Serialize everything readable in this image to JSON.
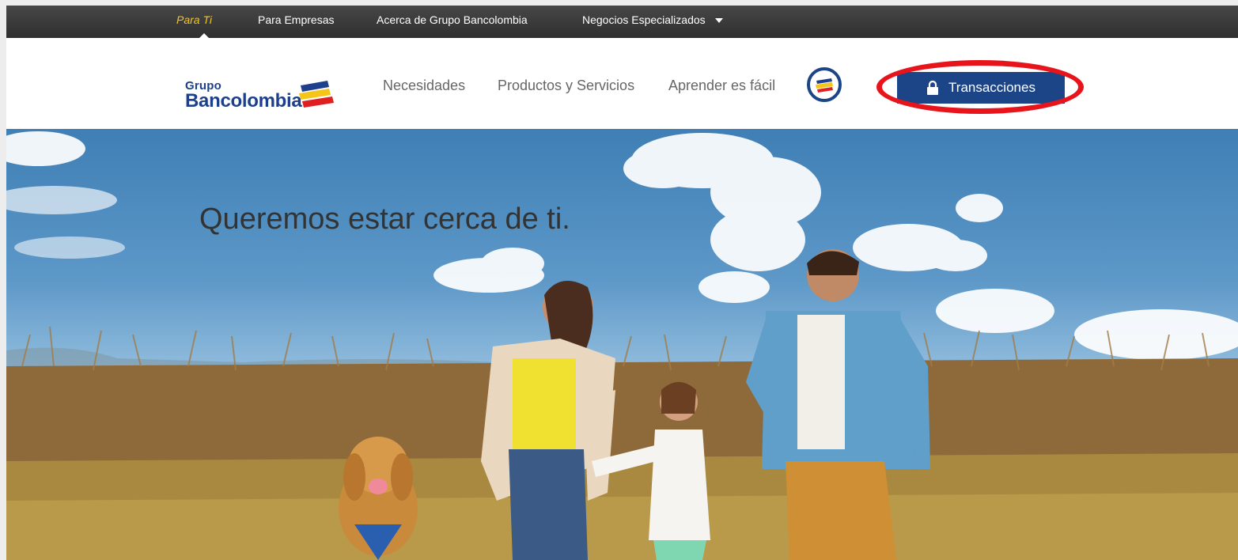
{
  "topbar": {
    "items": [
      {
        "label": "Para Ti",
        "active": true
      },
      {
        "label": "Para Empresas"
      },
      {
        "label": "Acerca de Grupo Bancolombia"
      },
      {
        "label": "Negocios Especializados"
      }
    ]
  },
  "header": {
    "logo": {
      "line1": "Grupo",
      "line2": "Bancolombia"
    },
    "nav": [
      {
        "label": "Necesidades"
      },
      {
        "label": "Productos y Servicios"
      },
      {
        "label": "Aprender es fácil"
      }
    ],
    "transactions_button": "Transacciones",
    "transactions_icon": "lock-icon"
  },
  "hero": {
    "title": "Queremos estar cerca de ti."
  },
  "colors": {
    "brand_blue": "#1c4587",
    "accent_yellow": "#f5c518",
    "highlight_red": "#e8141b"
  }
}
